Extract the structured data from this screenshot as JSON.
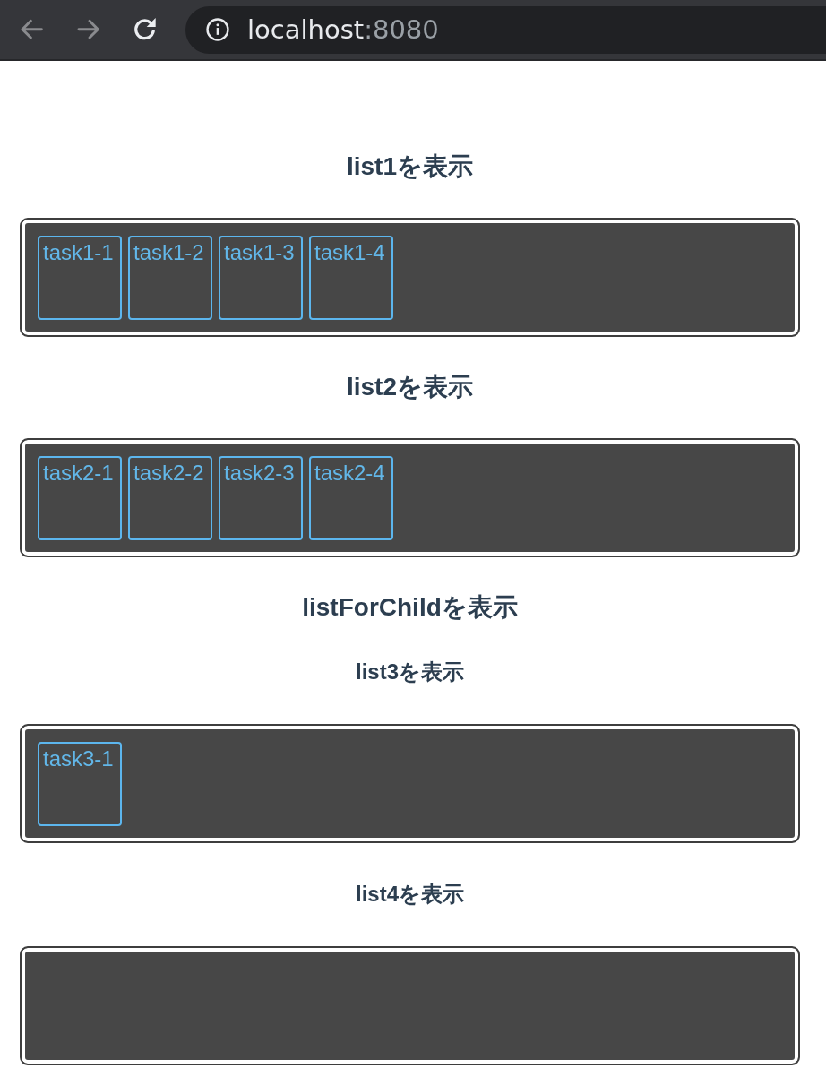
{
  "browser": {
    "nav_buttons": [
      {
        "kind": "back",
        "disabled": true
      },
      {
        "kind": "forward",
        "disabled": true
      },
      {
        "kind": "reload",
        "disabled": false
      }
    ],
    "address": {
      "host": "localhost",
      "port": ":8080"
    }
  },
  "lists": [
    {
      "title": "list1を表示",
      "tasks": [
        "task1-1",
        "task1-2",
        "task1-3",
        "task1-4"
      ]
    },
    {
      "title": "list2を表示",
      "tasks": [
        "task2-1",
        "task2-2",
        "task2-3",
        "task2-4"
      ]
    }
  ],
  "child_component": {
    "title": "listForChildを表示",
    "lists": [
      {
        "title": "list3を表示",
        "tasks": [
          "task3-1"
        ]
      },
      {
        "title": "list4を表示"
      }
    ]
  }
}
